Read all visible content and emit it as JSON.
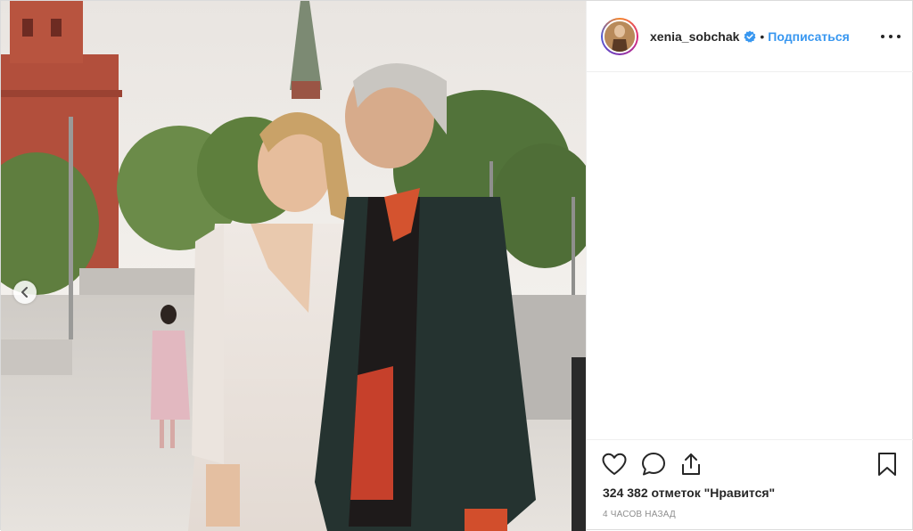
{
  "post": {
    "image_alt": "Couple posing in front of Kremlin wall",
    "author": {
      "username": "xenia_sobchak",
      "verified": true,
      "follow_label": "Подписаться",
      "separator": "•"
    },
    "likes_text": "324 382 отметок \"Нравится\"",
    "time_text": "4 часов назад",
    "icons": {
      "like": "heart-icon",
      "comment": "comment-icon",
      "share": "share-icon",
      "save": "bookmark-icon",
      "more": "more-options-icon",
      "prev": "chevron-left-icon",
      "verified": "verified-badge-icon"
    },
    "colors": {
      "follow": "#3897f0",
      "verified": "#3897f0",
      "text": "#262626",
      "muted": "#8e8e8e"
    }
  }
}
